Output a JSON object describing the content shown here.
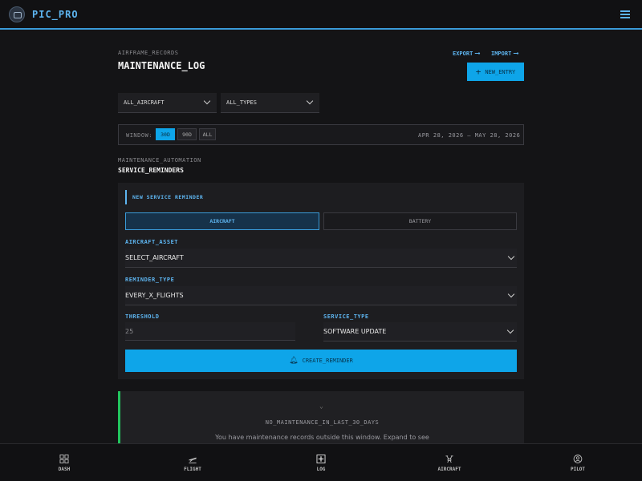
{
  "app": {
    "brand": "PIC_PRO"
  },
  "header": {
    "eyebrow": "AIRFRAME_RECORDS",
    "title": "MAINTENANCE_LOG",
    "export": "EXPORT",
    "import": "IMPORT",
    "new_entry": "NEW_ENTRY"
  },
  "filters": {
    "aircraft": "ALL_AIRCRAFT",
    "types": "ALL_TYPES"
  },
  "window": {
    "label": "WINDOW:",
    "options": [
      "30D",
      "90D",
      "ALL"
    ],
    "active": "30D",
    "range": "APR 28, 2026 — MAY 28, 2026"
  },
  "automation": {
    "eyebrow": "MAINTENANCE_AUTOMATION",
    "title": "SERVICE_REMINDERS"
  },
  "reminder": {
    "heading": "NEW SERVICE REMINDER",
    "tabs": [
      "AIRCRAFT",
      "BATTERY"
    ],
    "active_tab": "AIRCRAFT",
    "aircraft_asset_label": "AIRCRAFT_ASSET",
    "aircraft_asset_value": "SELECT_AIRCRAFT",
    "reminder_type_label": "REMINDER_TYPE",
    "reminder_type_value": "EVERY_X_FLIGHTS",
    "threshold_label": "THRESHOLD",
    "threshold_value": "25",
    "service_type_label": "SERVICE_TYPE",
    "service_type_value": "SOFTWARE UPDATE",
    "create_button": "CREATE_REMINDER"
  },
  "empty": {
    "title": "NO_MAINTENANCE_IN_LAST_30_DAYS",
    "message": "You have maintenance records outside this window. Expand to see"
  },
  "bottom_nav": [
    {
      "icon": "grid-icon",
      "label": "DASH"
    },
    {
      "icon": "plane-icon",
      "label": "FLIGHT"
    },
    {
      "icon": "plus-box-icon",
      "label": "LOG"
    },
    {
      "icon": "drone-icon",
      "label": "AIRCRAFT"
    },
    {
      "icon": "user-circle-icon",
      "label": "PILOT"
    }
  ],
  "colors": {
    "accent": "#0ea5e9",
    "link": "#5db4ef",
    "success": "#22c55e"
  }
}
